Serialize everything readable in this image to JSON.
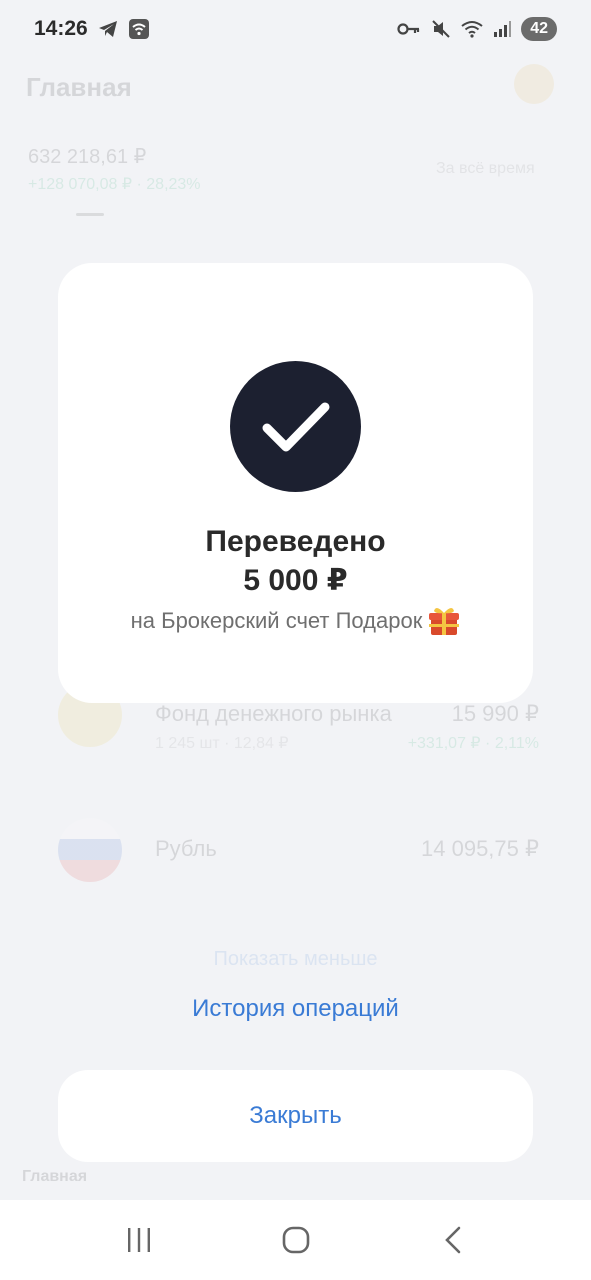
{
  "status_bar": {
    "time": "14:26",
    "battery": "42",
    "icons": [
      "telegram-icon",
      "wifi-box-icon",
      "key-icon",
      "mute-icon",
      "wifi-icon",
      "signal-icon"
    ]
  },
  "background": {
    "title": "Главная",
    "total": "632 218,61 ₽",
    "profit": "+128 070,08 ₽ · 28,23%",
    "period": "За всё время",
    "assets": [
      {
        "name": "Фонд денежного рынка",
        "sub": "1 245 шт · 12,84 ₽",
        "value": "15 990 ₽",
        "gain": "+331,07 ₽ · 2,11%"
      },
      {
        "name": "Рубль",
        "sub": "",
        "value": "14 095,75 ₽",
        "gain": ""
      }
    ],
    "show_more": "Показать меньше",
    "tab_home": "Главная"
  },
  "dialog": {
    "title": "Переведено",
    "amount": "5 000 ₽",
    "subtitle": "на Брокерский счет Подарок",
    "history_link": "История операций",
    "close_label": "Закрыть"
  },
  "colors": {
    "accent": "#3a7bd5",
    "check_bg": "#1c2030",
    "profit": "#1aa86b"
  }
}
